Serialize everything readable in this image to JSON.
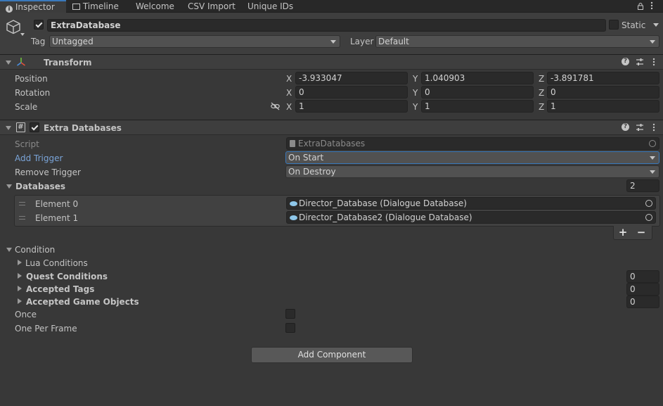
{
  "tabs": [
    {
      "label": "Inspector",
      "icon": "info-icon",
      "active": true
    },
    {
      "label": "Timeline",
      "icon": "film-icon"
    },
    {
      "label": "Welcome"
    },
    {
      "label": "CSV Import"
    },
    {
      "label": "Unique IDs"
    }
  ],
  "object": {
    "name": "ExtraDatabase",
    "static_label": "Static",
    "tag_label": "Tag",
    "tag_value": "Untagged",
    "layer_label": "Layer",
    "layer_value": "Default"
  },
  "transform": {
    "title": "Transform",
    "rows": [
      {
        "label": "Position",
        "x": "-3.933047",
        "y": "1.040903",
        "z": "-3.891781"
      },
      {
        "label": "Rotation",
        "x": "0",
        "y": "0",
        "z": "0"
      },
      {
        "label": "Scale",
        "x": "1",
        "y": "1",
        "z": "1"
      }
    ],
    "axes": {
      "x": "X",
      "y": "Y",
      "z": "Z"
    }
  },
  "extra": {
    "title": "Extra Databases",
    "script_label": "Script",
    "script_value": "ExtraDatabases",
    "add_trigger_label": "Add Trigger",
    "add_trigger_value": "On Start",
    "remove_trigger_label": "Remove Trigger",
    "remove_trigger_value": "On Destroy",
    "databases_label": "Databases",
    "databases_count": "2",
    "elements": [
      {
        "label": "Element 0",
        "value": "Director_Database (Dialogue Database)"
      },
      {
        "label": "Element 1",
        "value": "Director_Database2 (Dialogue Database)"
      }
    ],
    "plus": "+",
    "minus": "−",
    "condition_label": "Condition",
    "lua_label": "Lua Conditions",
    "quest_label": "Quest Conditions",
    "quest_value": "0",
    "tags_label": "Accepted Tags",
    "tags_value": "0",
    "gameobjects_label": "Accepted Game Objects",
    "gameobjects_value": "0",
    "once_label": "Once",
    "one_per_frame_label": "One Per Frame"
  },
  "add_component": "Add Component",
  "colors": {
    "accent": "#3a79bb",
    "link": "#7aa4d8"
  }
}
